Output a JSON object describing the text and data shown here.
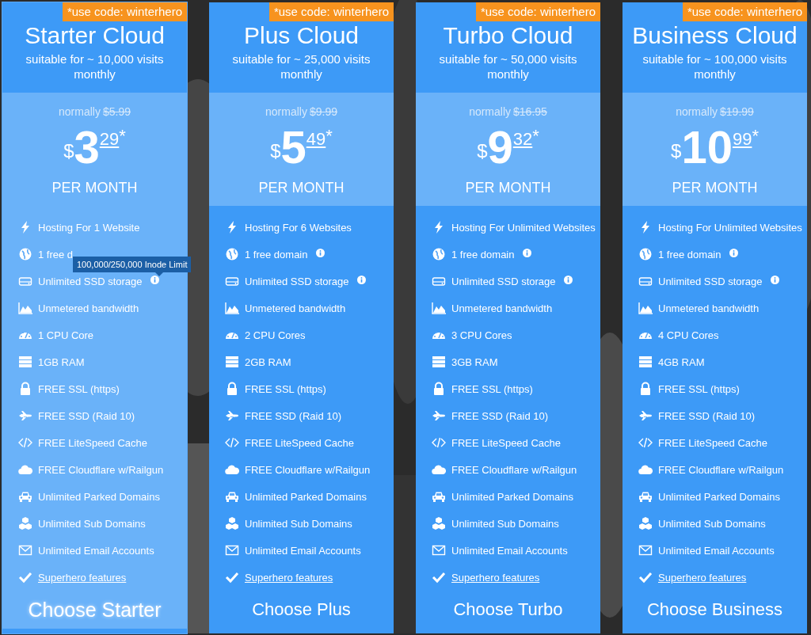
{
  "plans": [
    {
      "selected": true,
      "promo": "*use code: winterhero",
      "title": "Starter Cloud",
      "subtitle": "suitable for ~ 10,000 visits monthly",
      "normally": "normally",
      "old_price": "$5.99",
      "price": {
        "currency": "$",
        "whole": "3",
        "cents": "29",
        "mark": "*"
      },
      "period": "PER MONTH",
      "features": [
        {
          "text": "Hosting For 1 Website",
          "info": false
        },
        {
          "text": "1 free d",
          "info": false
        },
        {
          "text": "Unlimited SSD storage",
          "info": true,
          "tooltip": "100,000/250,000 Inode Limit"
        },
        {
          "text": "Unmetered bandwidth",
          "info": false
        },
        {
          "text": "1 CPU Core",
          "info": false
        },
        {
          "text": "1GB RAM",
          "info": false
        },
        {
          "text": "FREE SSL (https)",
          "info": false
        },
        {
          "text": "FREE SSD (Raid 10)",
          "info": false
        },
        {
          "text": "FREE LiteSpeed Cache",
          "info": false
        },
        {
          "text": "FREE Cloudflare w/Railgun",
          "info": false
        },
        {
          "text": "Unlimited Parked Domains",
          "info": false
        },
        {
          "text": "Unlimited Sub Domains",
          "info": false
        },
        {
          "text": "Unlimited Email Accounts",
          "info": false
        },
        {
          "text": "Superhero features",
          "info": false,
          "kind": "link"
        }
      ],
      "button": "Choose Starter"
    },
    {
      "selected": false,
      "promo": "*use code: winterhero",
      "title": "Plus Cloud",
      "subtitle": "suitable for ~ 25,000 visits monthly",
      "normally": "normally",
      "old_price": "$9.99",
      "price": {
        "currency": "$",
        "whole": "5",
        "cents": "49",
        "mark": "*"
      },
      "period": "PER MONTH",
      "features": [
        {
          "text": "Hosting For 6 Websites",
          "info": false
        },
        {
          "text": "1 free domain",
          "info": true
        },
        {
          "text": "Unlimited SSD storage",
          "info": true
        },
        {
          "text": "Unmetered bandwidth",
          "info": false
        },
        {
          "text": "2 CPU Cores",
          "info": false
        },
        {
          "text": "2GB RAM",
          "info": false
        },
        {
          "text": "FREE SSL (https)",
          "info": false
        },
        {
          "text": "FREE SSD (Raid 10)",
          "info": false
        },
        {
          "text": "FREE LiteSpeed Cache",
          "info": false
        },
        {
          "text": "FREE Cloudflare w/Railgun",
          "info": false
        },
        {
          "text": "Unlimited Parked Domains",
          "info": false
        },
        {
          "text": "Unlimited Sub Domains",
          "info": false
        },
        {
          "text": "Unlimited Email Accounts",
          "info": false
        },
        {
          "text": "Superhero features",
          "info": false,
          "kind": "link"
        }
      ],
      "button": "Choose Plus"
    },
    {
      "selected": false,
      "promo": "*use code: winterhero",
      "title": "Turbo Cloud",
      "subtitle": "suitable for ~ 50,000 visits monthly",
      "normally": "normally",
      "old_price": "$16.95",
      "price": {
        "currency": "$",
        "whole": "9",
        "cents": "32",
        "mark": "*"
      },
      "period": "PER MONTH",
      "features": [
        {
          "text": "Hosting For Unlimited Websites",
          "info": false
        },
        {
          "text": "1 free domain",
          "info": true
        },
        {
          "text": "Unlimited SSD storage",
          "info": true
        },
        {
          "text": "Unmetered bandwidth",
          "info": false
        },
        {
          "text": "3 CPU Cores",
          "info": false
        },
        {
          "text": "3GB RAM",
          "info": false
        },
        {
          "text": "FREE SSL (https)",
          "info": false
        },
        {
          "text": "FREE SSD (Raid 10)",
          "info": false
        },
        {
          "text": "FREE LiteSpeed Cache",
          "info": false
        },
        {
          "text": "FREE Cloudflare w/Railgun",
          "info": false
        },
        {
          "text": "Unlimited Parked Domains",
          "info": false
        },
        {
          "text": "Unlimited Sub Domains",
          "info": false
        },
        {
          "text": "Unlimited Email Accounts",
          "info": false
        },
        {
          "text": "Superhero features",
          "info": false,
          "kind": "link"
        }
      ],
      "button": "Choose Turbo"
    },
    {
      "selected": false,
      "promo": "*use code: winterhero",
      "title": "Business Cloud",
      "subtitle": "suitable for ~ 100,000 visits monthly",
      "normally": "normally",
      "old_price": "$19.99",
      "price": {
        "currency": "$",
        "whole": "10",
        "cents": "99",
        "mark": "*"
      },
      "period": "PER MONTH",
      "features": [
        {
          "text": "Hosting For Unlimited Websites",
          "info": false
        },
        {
          "text": "1 free domain",
          "info": true
        },
        {
          "text": "Unlimited SSD storage",
          "info": true
        },
        {
          "text": "Unmetered bandwidth",
          "info": false
        },
        {
          "text": "4 CPU Cores",
          "info": false
        },
        {
          "text": "4GB RAM",
          "info": false
        },
        {
          "text": "FREE SSL (https)",
          "info": false
        },
        {
          "text": "FREE SSD (Raid 10)",
          "info": false
        },
        {
          "text": "FREE LiteSpeed Cache",
          "info": false
        },
        {
          "text": "FREE Cloudflare w/Railgun",
          "info": false
        },
        {
          "text": "Unlimited Parked Domains",
          "info": false
        },
        {
          "text": "Unlimited Sub Domains",
          "info": false
        },
        {
          "text": "Unlimited Email Accounts",
          "info": false
        },
        {
          "text": "Superhero features",
          "info": false,
          "kind": "link"
        }
      ],
      "button": "Choose Business"
    }
  ]
}
